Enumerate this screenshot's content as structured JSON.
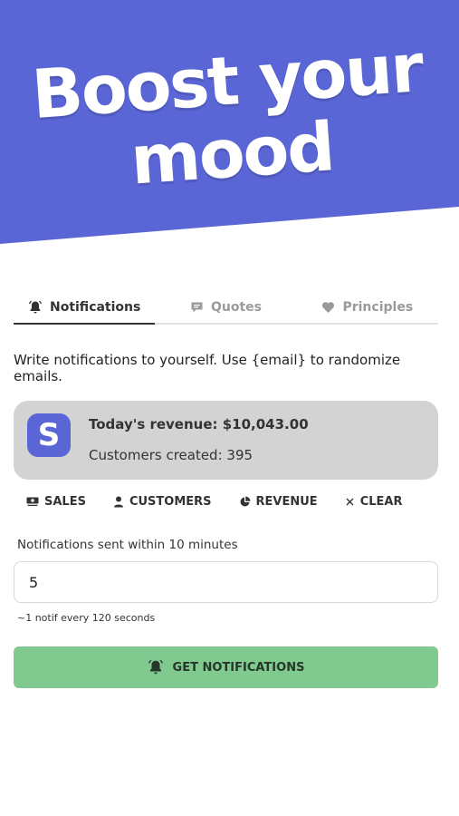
{
  "hero": {
    "title_line1": "Boost your",
    "title_line2": "mood",
    "background_color": "#5b66d6"
  },
  "tabs": [
    {
      "label": "Notifications",
      "icon": "bell-icon",
      "active": true
    },
    {
      "label": "Quotes",
      "icon": "speech-bubble-icon",
      "active": false
    },
    {
      "label": "Principles",
      "icon": "heart-icon",
      "active": false
    }
  ],
  "intro": "Write notifications to yourself. Use {email} to randomize emails.",
  "preview": {
    "app_icon_letter": "S",
    "app_icon_color": "#5b66d6",
    "line1": "Today's revenue: $10,043.00",
    "line2": "Customers created: 395"
  },
  "presets": [
    {
      "label": "SALES",
      "icon": "cash-icon"
    },
    {
      "label": "CUSTOMERS",
      "icon": "person-icon"
    },
    {
      "label": "REVENUE",
      "icon": "pie-chart-icon"
    },
    {
      "label": "CLEAR",
      "icon": "close-icon"
    }
  ],
  "frequency": {
    "label": "Notifications sent within 10 minutes",
    "value": "5",
    "helper": "~1 notif every 120 seconds"
  },
  "cta": {
    "label": "GET NOTIFICATIONS",
    "icon": "bell-icon",
    "color": "#80ca90"
  }
}
